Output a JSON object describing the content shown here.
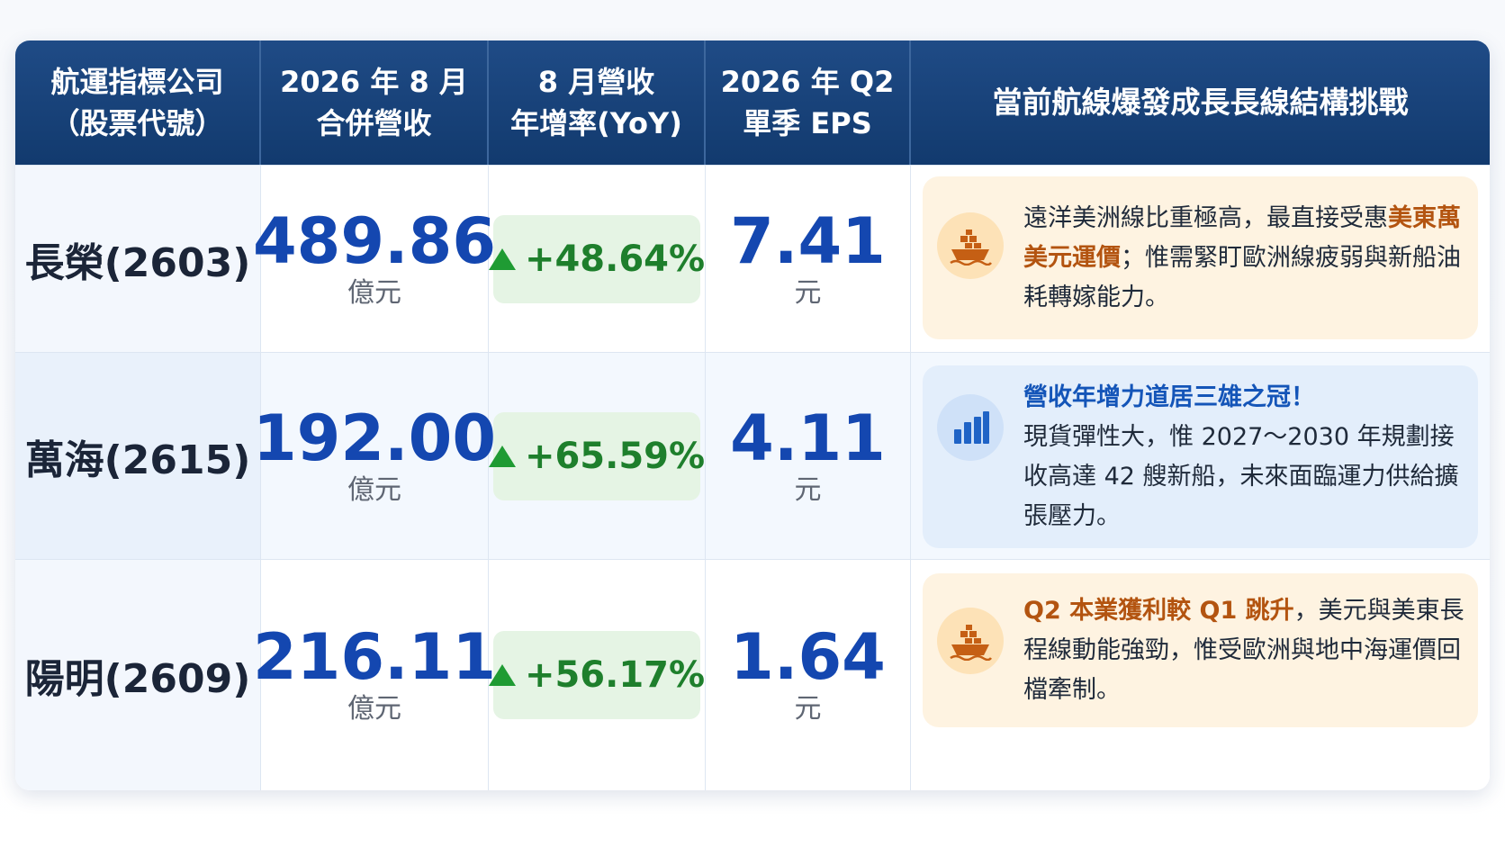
{
  "header": {
    "col1_line1": "航運指標公司",
    "col1_line2": "（股票代號）",
    "col2_line1": "2026 年 8 月",
    "col2_line2": "合併營收",
    "col3_line1": "8 月營收",
    "col3_line2": "年增率(YoY)",
    "col4_line1": "2026 年 Q2",
    "col4_line2": "單季 EPS",
    "col5": "當前航線爆發成長長線結構挑戰"
  },
  "rows": [
    {
      "company": "長榮(2603)",
      "revenue": "489.86",
      "revenue_unit": "億元",
      "yoy": "+48.64%",
      "eps": "7.41",
      "eps_unit": "元",
      "note_icon": "ship-icon",
      "note_pre": "遠洋美洲線比重極高，最直接受惠",
      "note_highlight": "美東萬美元運價",
      "note_post": "；惟需緊盯歐洲線疲弱與新船油耗轉嫁能力。"
    },
    {
      "company": "萬海(2615)",
      "revenue": "192.00",
      "revenue_unit": "億元",
      "yoy": "+65.59%",
      "eps": "4.11",
      "eps_unit": "元",
      "note_icon": "bar-chart-icon",
      "note_highlight": "營收年增力道居三雄之冠！",
      "note_post": "現貨彈性大，惟 2027～2030 年規劃接收高達 42 艘新船，未來面臨運力供給擴張壓力。"
    },
    {
      "company": "陽明(2609)",
      "revenue": "216.11",
      "revenue_unit": "億元",
      "yoy": "+56.17%",
      "eps": "1.64",
      "eps_unit": "元",
      "note_icon": "ship-icon",
      "note_highlight": "Q2 本業獲利較 Q1 跳升",
      "note_post": "，美元與美東長程線動能強勁，惟受歐洲與地中海運價回檔牽制。"
    }
  ],
  "colors": {
    "header_bg": "#173f76",
    "value_blue": "#1447b0",
    "yoy_green": "#1e7f2c",
    "note_orange": "#fef3e1",
    "note_blue": "#e3eefb",
    "highlight_orange": "#b35410",
    "highlight_blue": "#1455b8"
  }
}
